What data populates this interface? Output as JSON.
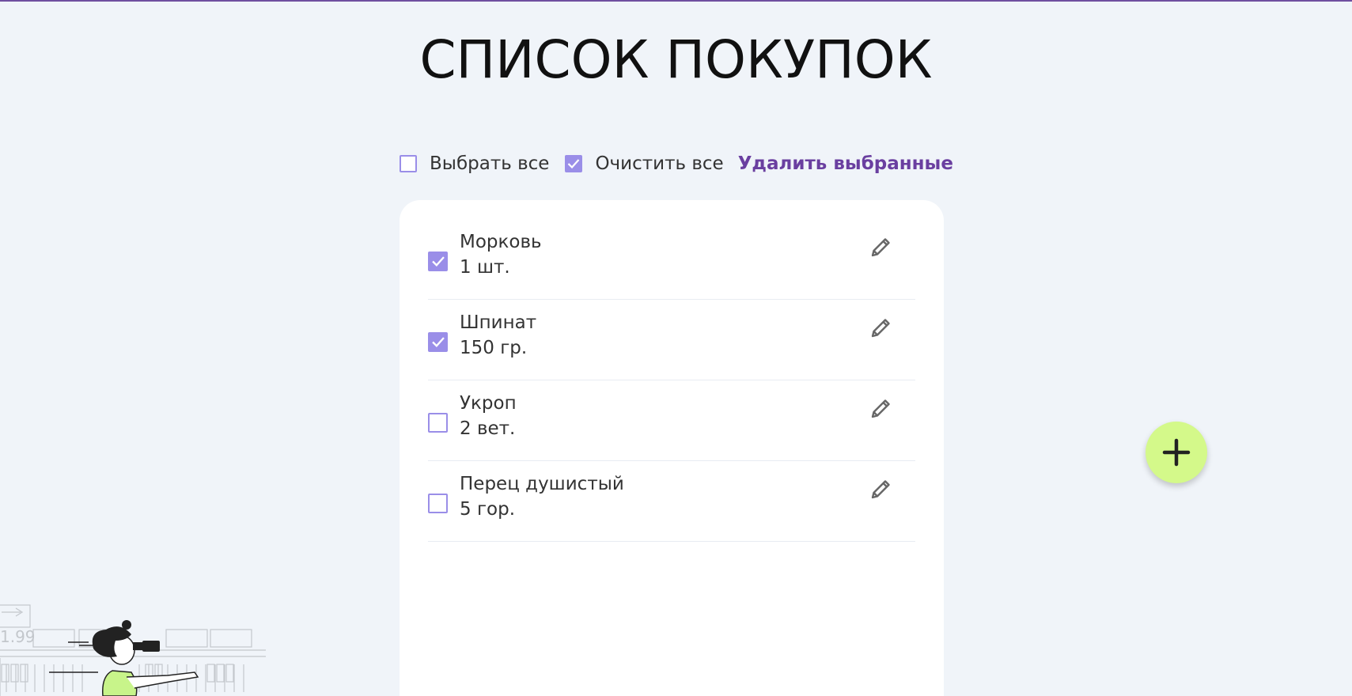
{
  "page": {
    "title": "СПИСОК ПОКУПОК"
  },
  "toolbar": {
    "select_all": {
      "label": "Выбрать все",
      "checked": false
    },
    "clear_all": {
      "label": "Очистить все",
      "checked": true
    },
    "delete_selected": "Удалить выбранные"
  },
  "items": [
    {
      "name": "Морковь",
      "quantity": "1 шт.",
      "checked": true,
      "edit_icon": "pencil-icon"
    },
    {
      "name": "Шпинат",
      "quantity": "150 гр.",
      "checked": true,
      "edit_icon": "pencil-icon"
    },
    {
      "name": "Укроп",
      "quantity": "2 вет.",
      "checked": false,
      "edit_icon": "pencil-icon"
    },
    {
      "name": "Перец душистый",
      "quantity": "5 гор.",
      "checked": false,
      "edit_icon": "pencil-icon"
    }
  ],
  "fab": {
    "icon": "plus-icon"
  },
  "illustration": {
    "price_tag": "1.99"
  },
  "colors": {
    "accent": "#9a8ee8",
    "link": "#6a3fa0",
    "fab": "#d4f98a",
    "background": "#f0f4f9"
  }
}
